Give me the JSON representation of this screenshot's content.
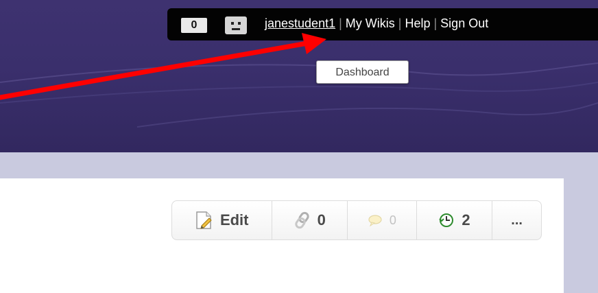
{
  "topbar": {
    "notification_count": "0",
    "username": "janestudent1",
    "separator": "|",
    "links": [
      "My Wikis",
      "Help",
      "Sign Out"
    ]
  },
  "tooltip": {
    "text": "Dashboard"
  },
  "page_toolbar": {
    "edit_label": "Edit",
    "links_count": "0",
    "comments_count": "0",
    "history_count": "2",
    "more_label": "..."
  },
  "colors": {
    "header": "#3a2f6c",
    "topbar": "#030303",
    "content_band": "#c9cadf",
    "arrow": "#ff0000"
  },
  "icons": {
    "avatar": "avatar-face-icon",
    "edit": "edit-page-icon",
    "links": "chain-link-icon",
    "comments": "speech-bubble-icon",
    "history": "history-clock-icon"
  }
}
